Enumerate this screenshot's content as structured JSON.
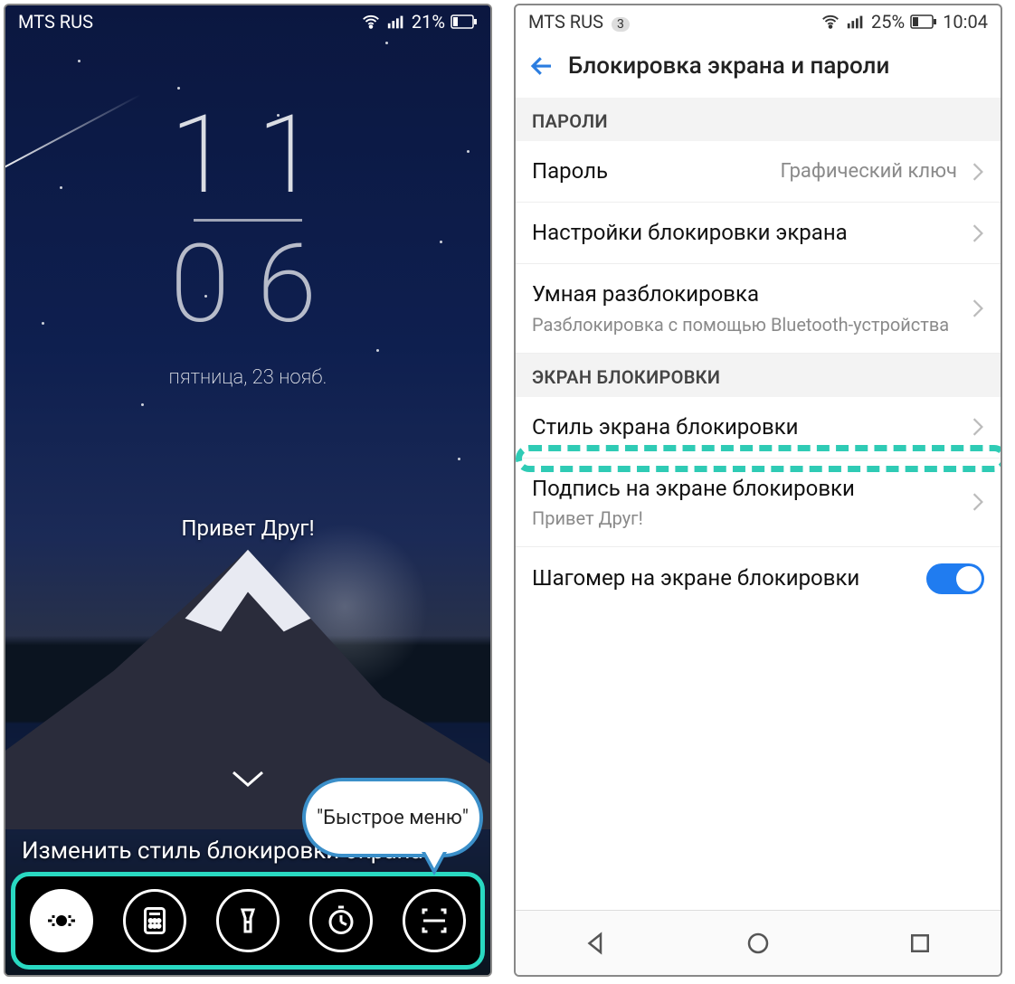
{
  "left": {
    "statusbar": {
      "carrier": "MTS RUS",
      "battery_pct": "21%"
    },
    "clock": {
      "hours": "11",
      "minutes": "06",
      "date": "пятница, 23 нояб."
    },
    "greeting": "Привет Друг!",
    "change_style_label": "Изменить стиль блокировки экрана",
    "callout": "\"Быстрое меню\"",
    "quickmenu_items": [
      "recorder",
      "calculator",
      "flashlight",
      "timer",
      "scanner"
    ]
  },
  "right": {
    "statusbar": {
      "carrier": "MTS RUS",
      "notif_count": "3",
      "battery_pct": "25%",
      "time": "10:04"
    },
    "title": "Блокировка экрана и пароли",
    "sections": {
      "passwords_header": "ПАРОЛИ",
      "lockscreen_header": "ЭКРАН БЛОКИРОВКИ"
    },
    "rows": {
      "password": {
        "label": "Пароль",
        "value": "Графический ключ"
      },
      "lock_settings": {
        "label": "Настройки блокировки экрана"
      },
      "smart_unlock": {
        "label": "Умная разблокировка",
        "sub": "Разблокировка с помощью Bluetooth-устройства"
      },
      "lock_style": {
        "label": "Стиль экрана блокировки"
      },
      "signature": {
        "label": "Подпись на экране блокировки",
        "sub": "Привет Друг!"
      },
      "pedometer": {
        "label": "Шагомер на экране блокировки",
        "on": true
      }
    }
  }
}
